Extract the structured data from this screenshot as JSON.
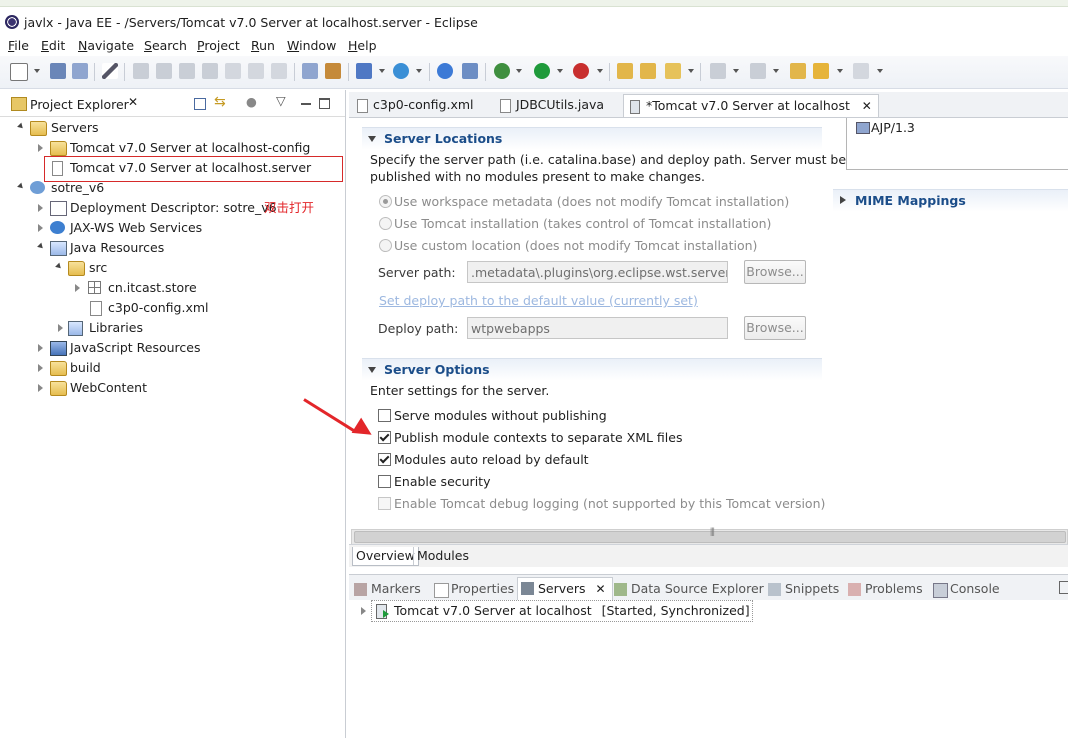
{
  "window": {
    "title": "javlx - Java EE - /Servers/Tomcat v7.0 Server at localhost.server - Eclipse"
  },
  "menu": [
    "File",
    "Edit",
    "Navigate",
    "Search",
    "Project",
    "Run",
    "Window",
    "Help"
  ],
  "colors": {
    "accent": "#1b4d89",
    "annotation": "#e3262a"
  },
  "project_explorer": {
    "title": "Project Explorer",
    "tree": [
      {
        "label": "Servers"
      },
      {
        "label": "Tomcat v7.0 Server at localhost-config"
      },
      {
        "label": "Tomcat v7.0 Server at localhost.server"
      },
      {
        "label": "sotre_v6"
      },
      {
        "label": "Deployment Descriptor: sotre_v6"
      },
      {
        "label": "JAX-WS Web Services"
      },
      {
        "label": "Java Resources"
      },
      {
        "label": "src"
      },
      {
        "label": "cn.itcast.store"
      },
      {
        "label": "c3p0-config.xml"
      },
      {
        "label": "Libraries"
      },
      {
        "label": "JavaScript Resources"
      },
      {
        "label": "build"
      },
      {
        "label": "WebContent"
      }
    ],
    "annotation_text": "双击打开"
  },
  "editor_tabs": [
    {
      "label": "c3p0-config.xml"
    },
    {
      "label": "JDBCUtils.java"
    },
    {
      "label": "*Tomcat v7.0 Server at localhost"
    }
  ],
  "server_locations": {
    "title": "Server Locations",
    "description": "Specify the server path (i.e. catalina.base) and deploy path. Server must be published with no modules present to make changes.",
    "description_line1": "Specify the server path (i.e. catalina.base) and deploy path. Server must be",
    "description_line2": "published with no modules present to make changes.",
    "options": [
      {
        "label": "Use workspace metadata (does not modify Tomcat installation)",
        "selected": true
      },
      {
        "label": "Use Tomcat installation (takes control of Tomcat installation)",
        "selected": false
      },
      {
        "label": "Use custom location (does not modify Tomcat installation)",
        "selected": false
      }
    ],
    "server_path_label": "Server path:",
    "server_path_value": ".metadata\\.plugins\\org.eclipse.wst.server.co",
    "browse_label": "Browse...",
    "set_default_link": "Set deploy path to the default value (currently set)",
    "deploy_path_label": "Deploy path:",
    "deploy_path_value": "wtpwebapps"
  },
  "server_options": {
    "title": "Server Options",
    "description": "Enter settings for the server.",
    "checkboxes": [
      {
        "label": "Serve modules without publishing",
        "checked": false,
        "enabled": true
      },
      {
        "label": "Publish module contexts to separate XML files",
        "checked": true,
        "enabled": true
      },
      {
        "label": "Modules auto reload by default",
        "checked": true,
        "enabled": true
      },
      {
        "label": "Enable security",
        "checked": false,
        "enabled": true
      },
      {
        "label": "Enable Tomcat debug logging (not supported by this Tomcat version)",
        "checked": false,
        "enabled": false
      }
    ]
  },
  "ports": {
    "ajp_item": "AJP/1.3"
  },
  "mime": {
    "title": "MIME Mappings"
  },
  "page_tabs": [
    "Overview",
    "Modules"
  ],
  "bottom_views": [
    {
      "label": "Markers"
    },
    {
      "label": "Properties"
    },
    {
      "label": "Servers"
    },
    {
      "label": "Data Source Explorer"
    },
    {
      "label": "Snippets"
    },
    {
      "label": "Problems"
    },
    {
      "label": "Console"
    }
  ],
  "servers_view": {
    "entry": "Tomcat v7.0 Server at localhost",
    "status": "[Started, Synchronized]"
  }
}
